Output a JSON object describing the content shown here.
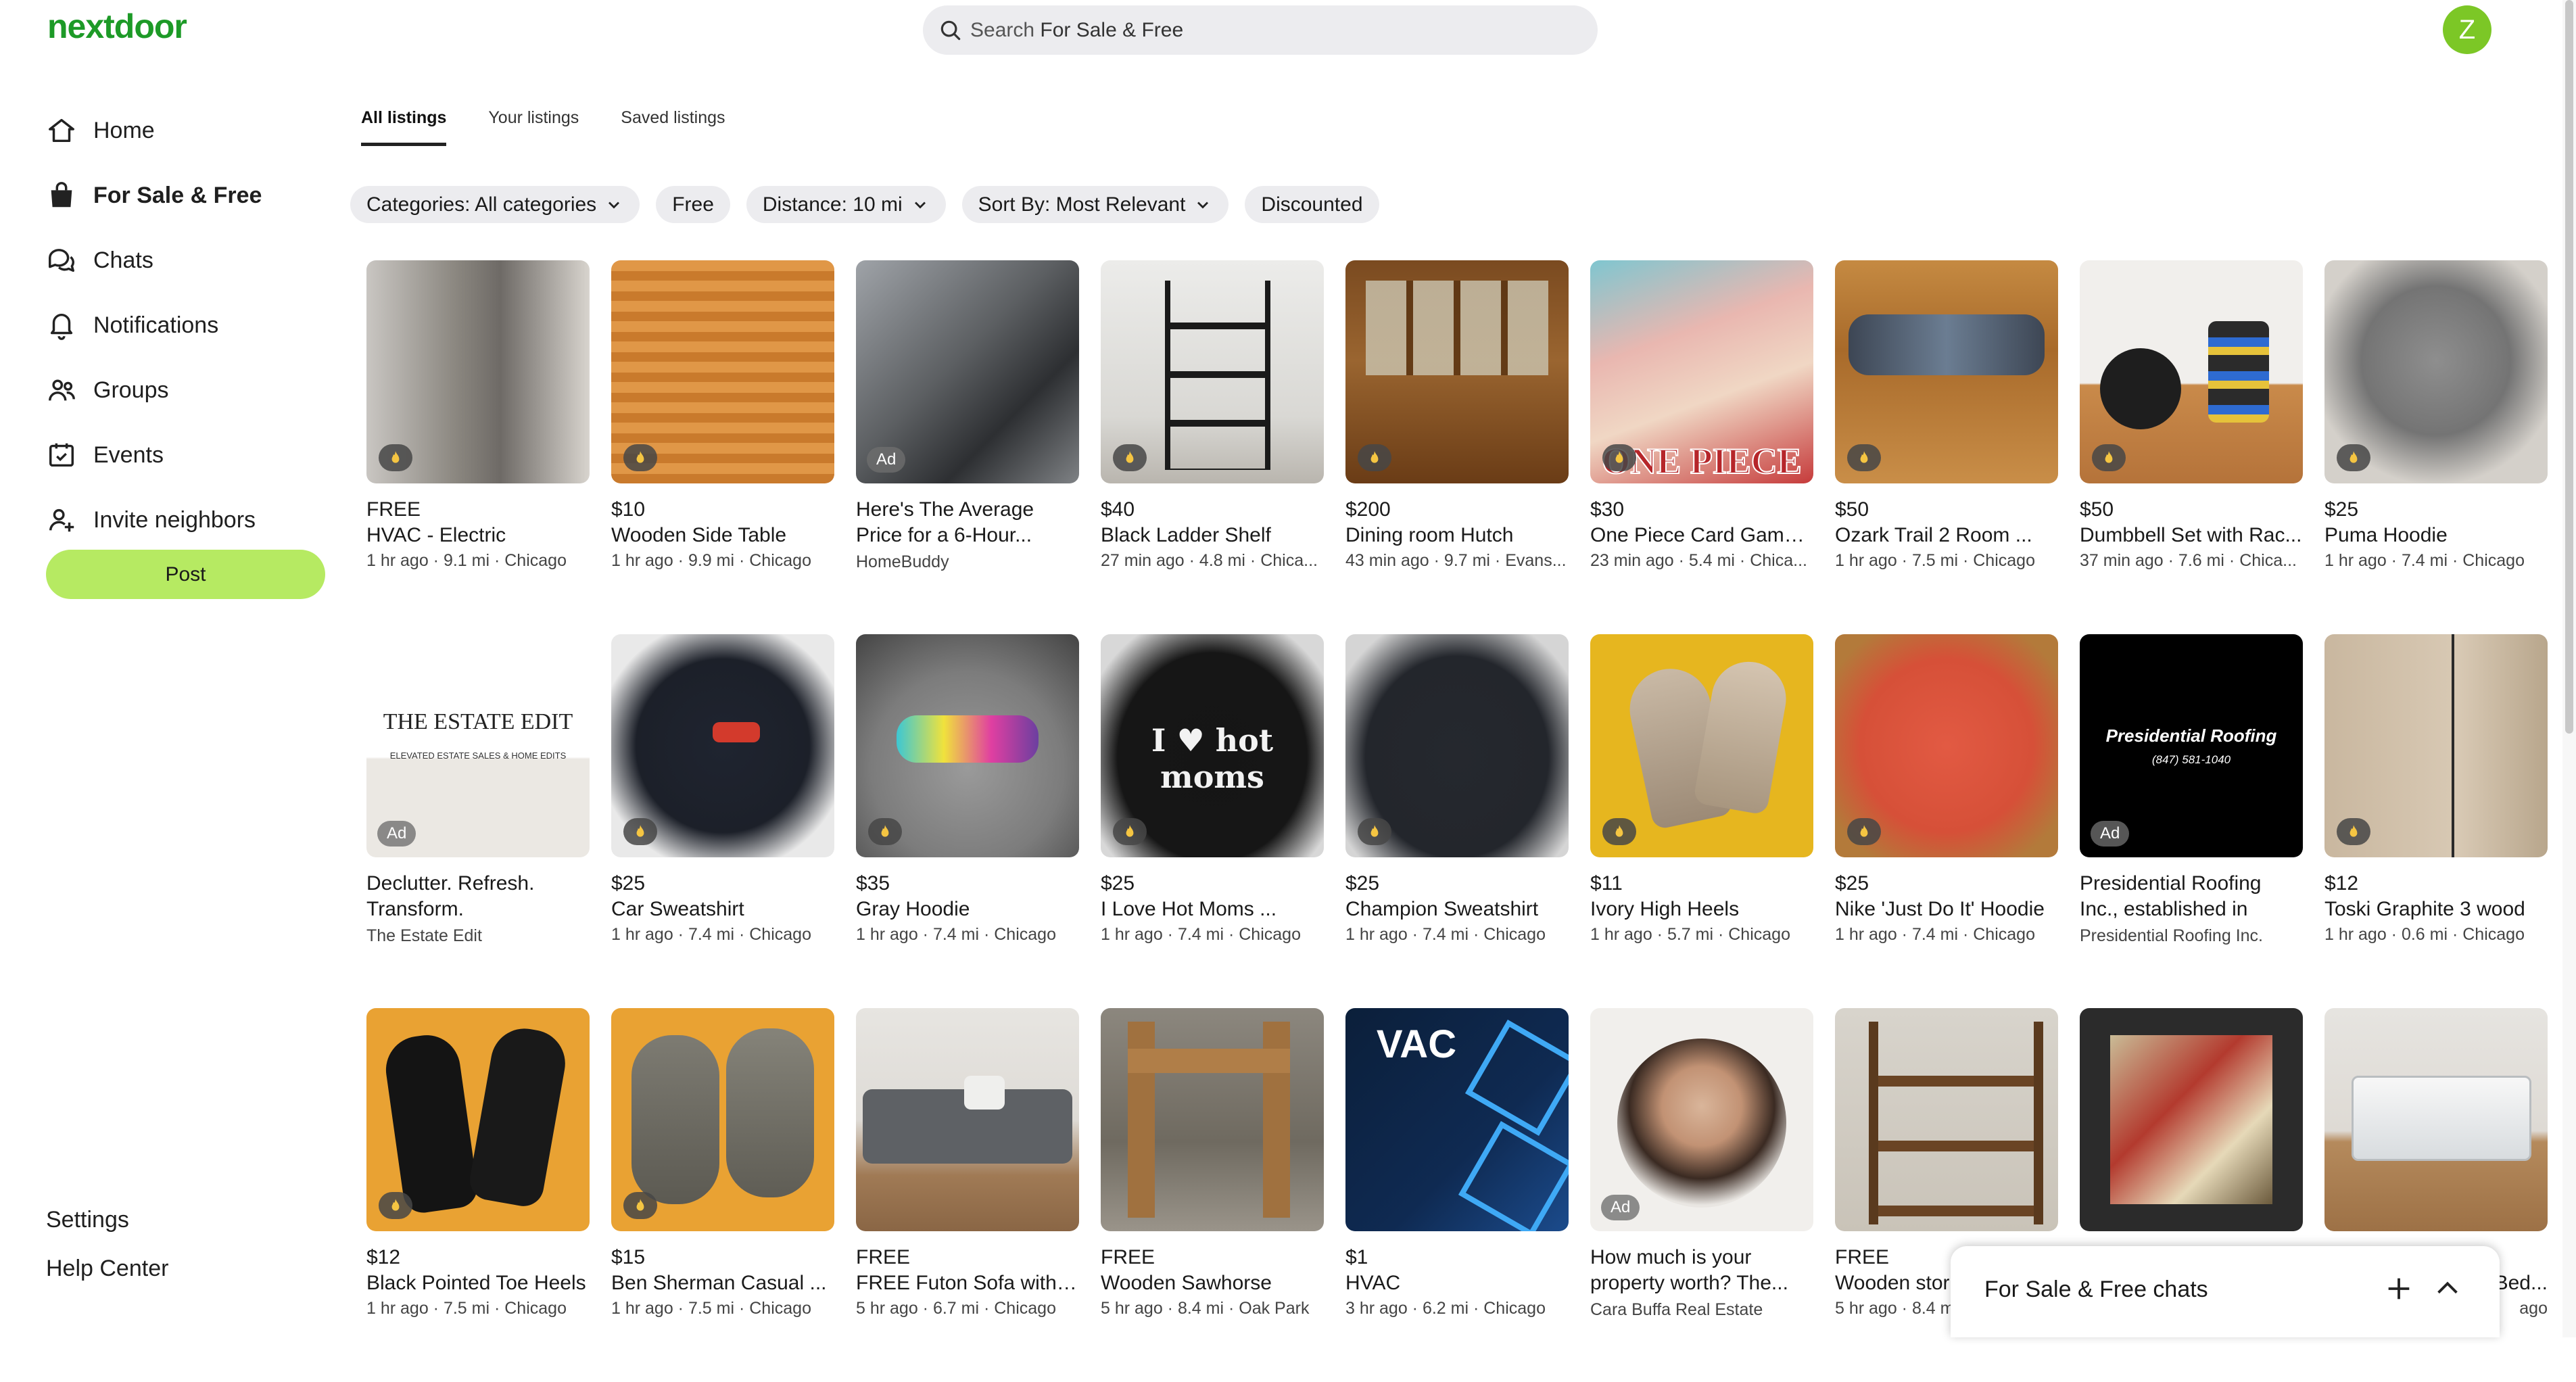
{
  "brand": {
    "logo": "nextdoor",
    "accent": "#1d9a27"
  },
  "search": {
    "prefix": "Search ",
    "scope": "For Sale & Free"
  },
  "user": {
    "initial": "Z",
    "avatar_color": "#7cc726"
  },
  "nav": {
    "items": [
      {
        "label": "Home",
        "icon": "home-icon"
      },
      {
        "label": "For Sale & Free",
        "icon": "shopping-bag-icon",
        "active": true
      },
      {
        "label": "Chats",
        "icon": "chat-bubbles-icon"
      },
      {
        "label": "Notifications",
        "icon": "bell-icon"
      },
      {
        "label": "Groups",
        "icon": "groups-icon"
      },
      {
        "label": "Events",
        "icon": "calendar-icon"
      },
      {
        "label": "Invite neighbors",
        "icon": "add-person-icon"
      }
    ],
    "post_label": "Post",
    "post_color": "#b6ea62"
  },
  "footer": {
    "settings": "Settings",
    "help": "Help Center"
  },
  "tabs": [
    "All listings",
    "Your listings",
    "Saved listings"
  ],
  "filters": {
    "categories": "Categories: All categories",
    "free": "Free",
    "distance": "Distance: 10 mi",
    "sort": "Sort By: Most Relevant",
    "discounted": "Discounted"
  },
  "listings": [
    {
      "price": "FREE",
      "title": "HVAC - Electric",
      "meta": "1 hr ago · 9.1 mi · Chicago"
    },
    {
      "price": "$10",
      "title": "Wooden Side Table",
      "meta": "1 hr ago · 9.9 mi · Chicago"
    },
    {
      "ad": true,
      "title": "Here's The Average Price for a 6-Hour...",
      "advertiser": "HomeBuddy"
    },
    {
      "price": "$40",
      "title": "Black Ladder Shelf",
      "meta": "27 min ago · 4.8 mi · Chica..."
    },
    {
      "price": "$200",
      "title": "Dining room Hutch",
      "meta": "43 min ago · 9.7 mi · Evans..."
    },
    {
      "price": "$30",
      "title": "One Piece Card Game ...",
      "meta": "23 min ago · 5.4 mi · Chica...",
      "thumb_text": "ONE PIECE"
    },
    {
      "price": "$50",
      "title": "Ozark Trail 2 Room ...",
      "meta": "1 hr ago · 7.5 mi · Chicago"
    },
    {
      "price": "$50",
      "title": "Dumbbell Set with Rac...",
      "meta": "37 min ago · 7.6 mi · Chica..."
    },
    {
      "price": "$25",
      "title": "Puma Hoodie",
      "meta": "1 hr ago · 7.4 mi · Chicago"
    },
    {
      "ad": true,
      "title": "Declutter. Refresh. Transform.",
      "advertiser": "The Estate Edit",
      "thumb_text": "THE ESTATE EDIT",
      "thumb_sub": "ELEVATED ESTATE SALES & HOME EDITS"
    },
    {
      "price": "$25",
      "title": "Car Sweatshirt",
      "meta": "1 hr ago · 7.4 mi · Chicago"
    },
    {
      "price": "$35",
      "title": "Gray Hoodie",
      "meta": "1 hr ago · 7.4 mi · Chicago"
    },
    {
      "price": "$25",
      "title": "I Love Hot Moms ...",
      "meta": "1 hr ago · 7.4 mi · Chicago",
      "thumb_text": "I ♥ hot moms"
    },
    {
      "price": "$25",
      "title": "Champion Sweatshirt",
      "meta": "1 hr ago · 7.4 mi · Chicago"
    },
    {
      "price": "$11",
      "title": "Ivory High Heels",
      "meta": "1 hr ago · 5.7 mi · Chicago"
    },
    {
      "price": "$25",
      "title": "Nike 'Just Do It' Hoodie",
      "meta": "1 hr ago · 7.4 mi · Chicago"
    },
    {
      "ad": true,
      "title": "Presidential Roofing Inc., established in 199...",
      "advertiser": "Presidential Roofing Inc.",
      "thumb_text": "Presidential Roofing",
      "thumb_sub": "(847) 581-1040"
    },
    {
      "price": "$12",
      "title": "Toski Graphite 3 wood",
      "meta": "1 hr ago · 0.6 mi · Chicago"
    },
    {
      "price": "$12",
      "title": "Black Pointed Toe Heels",
      "meta": "1 hr ago · 7.5 mi · Chicago"
    },
    {
      "price": "$15",
      "title": "Ben Sherman Casual ...",
      "meta": "1 hr ago · 7.5 mi · Chicago"
    },
    {
      "price": "FREE",
      "title": "FREE Futon Sofa with ...",
      "meta": "5 hr ago · 6.7 mi · Chicago"
    },
    {
      "price": "FREE",
      "title": "Wooden Sawhorse",
      "meta": "5 hr ago · 8.4 mi · Oak Park"
    },
    {
      "price": "$1",
      "title": "HVAC",
      "meta": "3 hr ago · 6.2 mi · Chicago",
      "thumb_text": "VAC"
    },
    {
      "ad": true,
      "title": "How much is your property worth? The...",
      "advertiser": "Cara Buffa Real Estate"
    },
    {
      "price": "FREE",
      "title": "Wooden stor",
      "meta": "5 hr ago · 8.4 m"
    },
    {
      "price": "",
      "title": "",
      "meta": ""
    },
    {
      "price": "",
      "title": "Bed...",
      "meta": "ago"
    }
  ],
  "ad_label": "Ad",
  "chat_dock": {
    "title": "For Sale & Free chats"
  }
}
